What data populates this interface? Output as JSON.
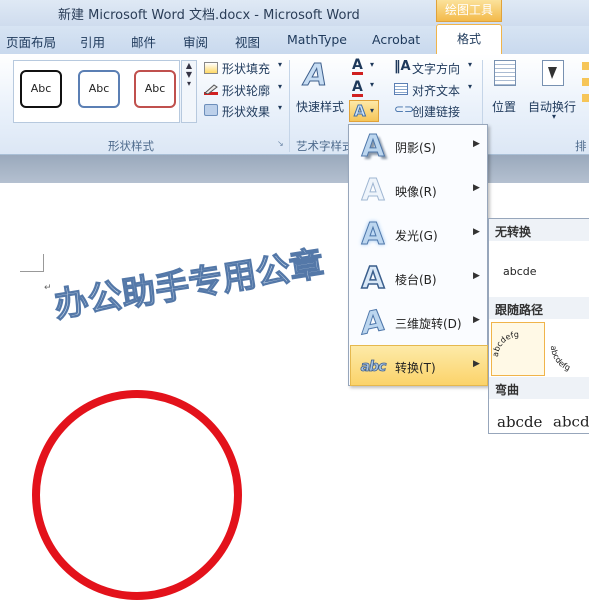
{
  "window": {
    "title": "新建 Microsoft Word 文档.docx  -  Microsoft Word",
    "contextual_tab_group": "绘图工具"
  },
  "tabs": [
    "页面布局",
    "引用",
    "邮件",
    "审阅",
    "视图",
    "MathType",
    "Acrobat",
    "格式"
  ],
  "shape_styles": {
    "samples": [
      {
        "label": "Abc",
        "border": "#111111"
      },
      {
        "label": "Abc",
        "border": "#5b7fb4"
      },
      {
        "label": "Abc",
        "border": "#c0504d"
      }
    ],
    "fill": "形状填充",
    "outline": "形状轮廓",
    "effects": "形状效果",
    "group_label": "形状样式"
  },
  "wordart_styles": {
    "quick_styles": "快速样式",
    "group_label": "艺术字样式"
  },
  "text_group": {
    "direction": "文字方向",
    "align": "对齐文本",
    "link": "创建链接"
  },
  "arrange": {
    "position": "位置",
    "wrap": "自动换行",
    "group_label_partial": "排"
  },
  "document": {
    "wordart_text": "办公助手专用公章"
  },
  "text_effects_menu": [
    {
      "label": "阴影(S)",
      "icon": "shadow-effect-icon"
    },
    {
      "label": "映像(R)",
      "icon": "reflection-effect-icon"
    },
    {
      "label": "发光(G)",
      "icon": "glow-effect-icon"
    },
    {
      "label": "棱台(B)",
      "icon": "bevel-effect-icon"
    },
    {
      "label": "三维旋转(D)",
      "icon": "3d-rotation-effect-icon"
    },
    {
      "label": "转换(T)",
      "icon": "transform-effect-icon"
    }
  ],
  "transform_panel": {
    "no_transform": "无转换",
    "no_transform_sample": "abcde",
    "follow_path": "跟随路径",
    "follow_path_sample": "abcdefg",
    "follow_path_sample2": "abcdefg",
    "warp": "弯曲",
    "warp_sample1": "abcde",
    "warp_sample2": "abcde"
  },
  "colors": {
    "accent": "#f0b44a",
    "circle": "#e3121b",
    "wordart_outline": "#5478a8"
  }
}
